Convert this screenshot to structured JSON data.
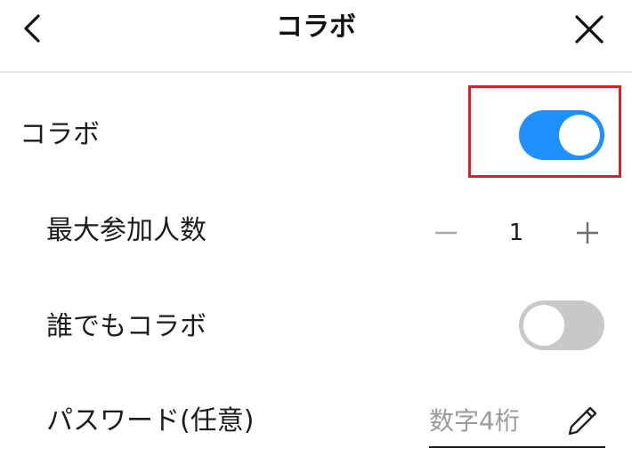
{
  "header": {
    "title": "コラボ",
    "back_icon": "chevron-left-icon",
    "close_icon": "close-icon"
  },
  "collab": {
    "label": "コラボ",
    "enabled": true
  },
  "max_participants": {
    "label": "最大参加人数",
    "value": "1",
    "minus_icon": "minus-icon",
    "plus_icon": "plus-icon"
  },
  "anyone_collab": {
    "label": "誰でもコラボ",
    "enabled": false
  },
  "password": {
    "label": "パスワード(任意)",
    "placeholder": "数字4桁",
    "edit_icon": "pencil-icon"
  },
  "colors": {
    "toggle_on": "#1e90ff",
    "toggle_off": "#c8c8c8",
    "highlight": "#d9202a"
  }
}
